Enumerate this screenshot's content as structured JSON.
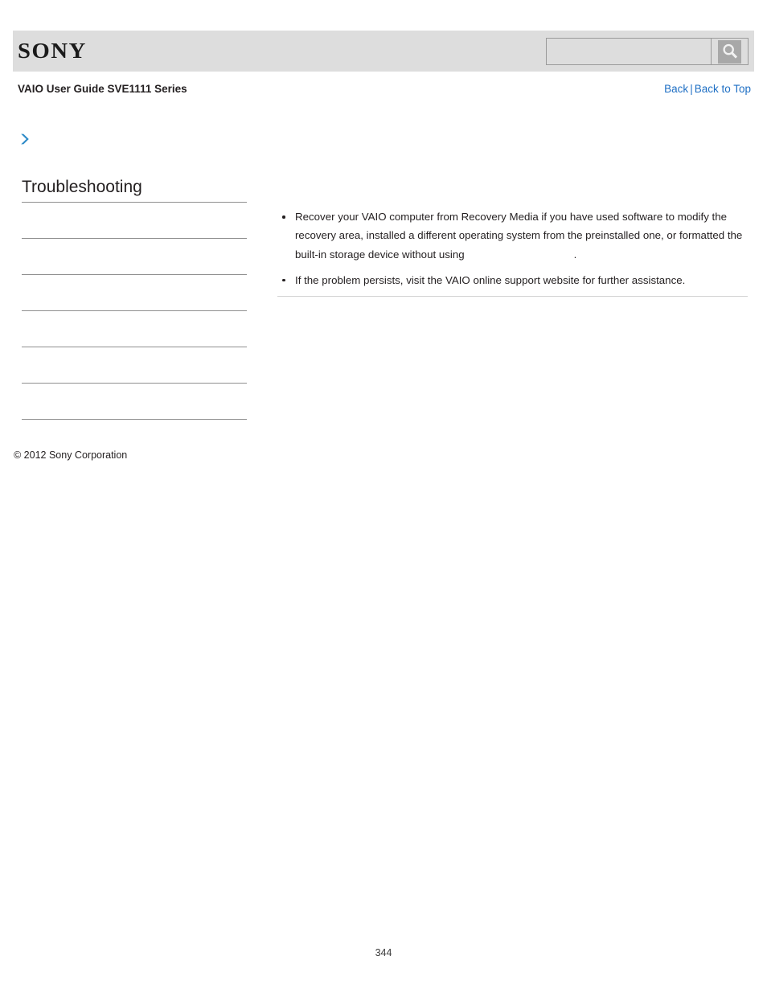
{
  "header": {
    "logo_text": "SONY",
    "search": {
      "value": "",
      "placeholder": "",
      "icon": "search-icon"
    }
  },
  "subheader": {
    "guide_title": "VAIO User Guide SVE1111 Series",
    "back_label": "Back",
    "separator": "|",
    "back_to_top_label": "Back to Top"
  },
  "breadcrumb": {
    "icon": "chevron-right-icon",
    "text": ""
  },
  "sidebar": {
    "title": "Troubleshooting",
    "items": [
      {
        "label": ""
      },
      {
        "label": ""
      },
      {
        "label": ""
      },
      {
        "label": ""
      },
      {
        "label": ""
      },
      {
        "label": ""
      }
    ],
    "copyright": "© 2012 Sony Corporation"
  },
  "main": {
    "bullets": [
      {
        "text_before": "Recover your VAIO computer from Recovery Media if you have used software to modify the recovery area, installed a different operating system from the preinstalled one, or formatted the built-in storage device without using",
        "text_after": "."
      },
      {
        "text_before": "If the problem persists, visit the VAIO online support website for further assistance.",
        "text_after": ""
      }
    ]
  },
  "footer": {
    "page_number": "344"
  },
  "colors": {
    "header_band": "#dddddd",
    "link_blue": "#1e6fc4",
    "chevron_blue": "#2d8ac7",
    "rule_gray": "#8f8f8f",
    "text": "#231f20"
  }
}
